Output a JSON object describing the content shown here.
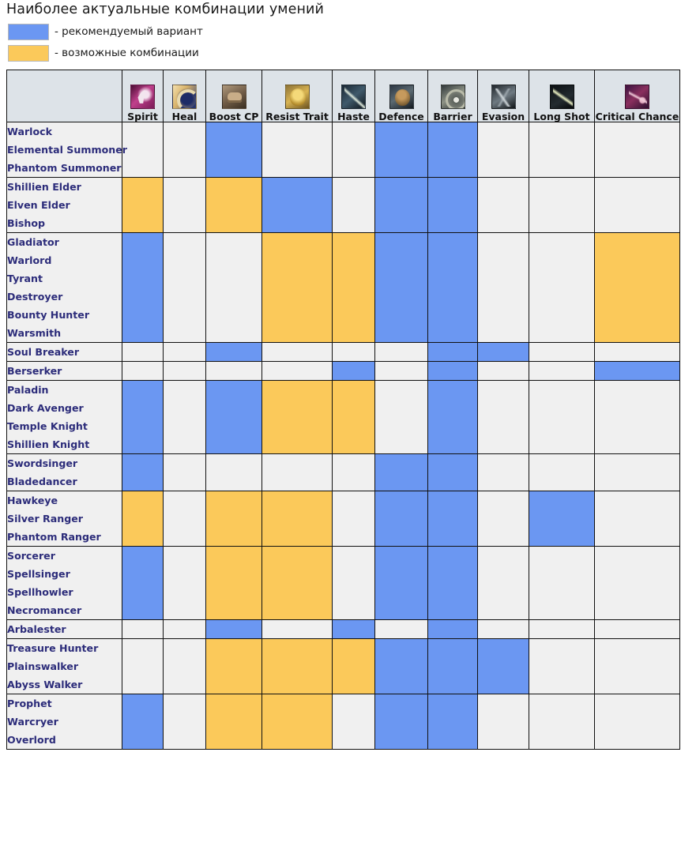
{
  "title": "Наиболее актуальные комбинации умений",
  "colors": {
    "recommended": "#6b97f2",
    "possible": "#fbc95a",
    "empty": "#f0f0f0",
    "header_bg": "#dde3e8",
    "grid_line": "#111111",
    "class_text": "#2c2c7a"
  },
  "legend": [
    {
      "swatch": "#6b97f2",
      "label": "- рекомендуемый вариант"
    },
    {
      "swatch": "#fbc95a",
      "label": "- возможные комбинации"
    }
  ],
  "columns": [
    {
      "label": "Spirit",
      "icon": "spirit-icon"
    },
    {
      "label": "Heal",
      "icon": "heal-icon"
    },
    {
      "label": "Boost CP",
      "icon": "boost-cp-icon"
    },
    {
      "label": "Resist Trait",
      "icon": "resist-trait-icon"
    },
    {
      "label": "Haste",
      "icon": "haste-icon"
    },
    {
      "label": "Defence",
      "icon": "defence-icon"
    },
    {
      "label": "Barrier",
      "icon": "barrier-icon"
    },
    {
      "label": "Evasion",
      "icon": "evasion-icon"
    },
    {
      "label": "Long Shot",
      "icon": "long-shot-icon"
    },
    {
      "label": "Critical Chance",
      "icon": "critical-chance-icon"
    }
  ],
  "rows": [
    {
      "classes": [
        "Warlock",
        "Elemental Summoner",
        "Phantom Summoner"
      ],
      "cells": [
        "",
        "",
        "blue",
        "",
        "",
        "blue",
        "blue",
        "",
        "",
        ""
      ]
    },
    {
      "classes": [
        "Shillien Elder",
        "Elven Elder",
        "Bishop"
      ],
      "cells": [
        "orange",
        "",
        "orange",
        "blue",
        "",
        "blue",
        "blue",
        "",
        "",
        ""
      ]
    },
    {
      "classes": [
        "Gladiator",
        "Warlord",
        "Tyrant",
        "Destroyer",
        "Bounty Hunter",
        "Warsmith"
      ],
      "cells": [
        "blue",
        "",
        "",
        "orange",
        "orange",
        "blue",
        "blue",
        "",
        "",
        "orange"
      ]
    },
    {
      "classes": [
        "Soul Breaker"
      ],
      "cells": [
        "",
        "",
        "blue",
        "",
        "",
        "",
        "blue",
        "blue",
        "",
        ""
      ]
    },
    {
      "classes": [
        "Berserker"
      ],
      "cells": [
        "",
        "",
        "",
        "",
        "blue",
        "",
        "blue",
        "",
        "",
        "blue"
      ]
    },
    {
      "classes": [
        "Paladin",
        "Dark Avenger",
        "Temple Knight",
        "Shillien Knight"
      ],
      "cells": [
        "blue",
        "",
        "blue",
        "orange",
        "orange",
        "",
        "blue",
        "",
        "",
        ""
      ]
    },
    {
      "classes": [
        "Swordsinger",
        "Bladedancer"
      ],
      "cells": [
        "blue",
        "",
        "",
        "",
        "",
        "blue",
        "blue",
        "",
        "",
        ""
      ]
    },
    {
      "classes": [
        "Hawkeye",
        "Silver Ranger",
        "Phantom Ranger"
      ],
      "cells": [
        "orange",
        "",
        "orange",
        "orange",
        "",
        "blue",
        "blue",
        "",
        "blue",
        ""
      ]
    },
    {
      "classes": [
        "Sorcerer",
        "Spellsinger",
        "Spellhowler",
        "Necromancer"
      ],
      "cells": [
        "blue",
        "",
        "orange",
        "orange",
        "",
        "blue",
        "blue",
        "",
        "",
        ""
      ]
    },
    {
      "classes": [
        "Arbalester"
      ],
      "cells": [
        "",
        "",
        "blue",
        "",
        "blue",
        "",
        "blue",
        "",
        "",
        ""
      ]
    },
    {
      "classes": [
        "Treasure Hunter",
        "Plainswalker",
        "Abyss Walker"
      ],
      "cells": [
        "",
        "",
        "orange",
        "orange",
        "orange",
        "blue",
        "blue",
        "blue",
        "",
        ""
      ]
    },
    {
      "classes": [
        "Prophet",
        "Warcryer",
        "Overlord"
      ],
      "cells": [
        "blue",
        "",
        "orange",
        "orange",
        "",
        "blue",
        "blue",
        "",
        "",
        ""
      ]
    }
  ]
}
